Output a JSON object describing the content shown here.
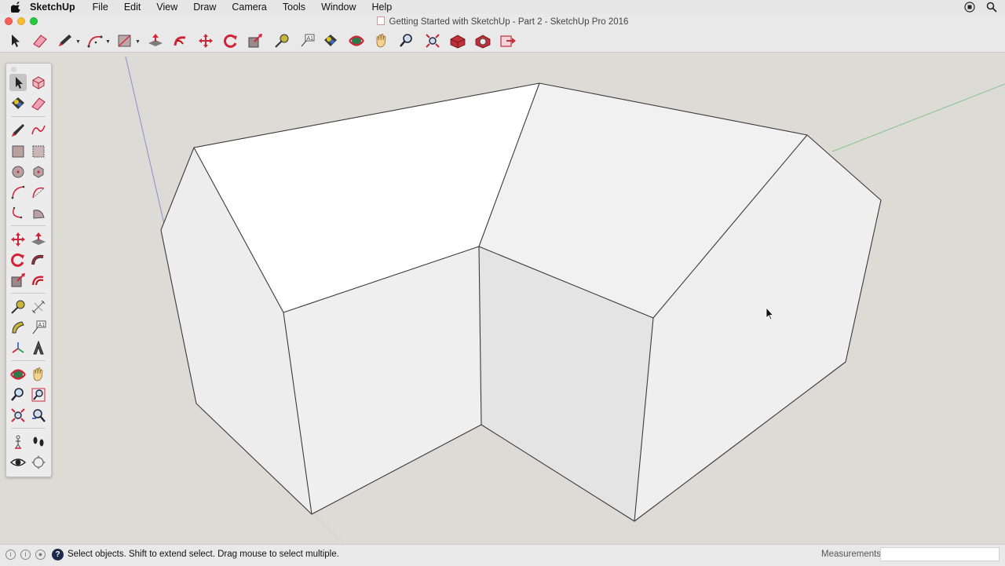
{
  "app_menu": {
    "app_name": "SketchUp",
    "items": [
      "File",
      "Edit",
      "View",
      "Draw",
      "Camera",
      "Tools",
      "Window",
      "Help"
    ]
  },
  "window": {
    "title": "Getting Started with SketchUp - Part 2 - SketchUp Pro 2016"
  },
  "toolbar": {
    "tools": [
      "select-icon",
      "eraser-icon",
      "line-pencil-icon",
      "arc-icon",
      "rectangle-icon",
      "push-pull-icon",
      "follow-me-icon",
      "move-icon",
      "rotate-icon",
      "scale-icon",
      "tape-measure-icon",
      "text-icon",
      "paint-bucket-icon",
      "orbit-icon",
      "pan-icon",
      "zoom-icon",
      "zoom-extents-icon",
      "3d-warehouse-icon",
      "extension-warehouse-icon",
      "send-to-layout-icon"
    ]
  },
  "tool_palette": {
    "selected": "select-icon",
    "tools": [
      "select-icon",
      "make-component-icon",
      "paint-bucket-icon",
      "eraser-icon",
      "line-icon",
      "freehand-icon",
      "rectangle-icon",
      "rotated-rectangle-icon",
      "circle-icon",
      "polygon-icon",
      "arc-icon",
      "two-point-arc-icon",
      "three-point-arc-icon",
      "pie-icon",
      "move-icon",
      "push-pull-icon",
      "rotate-icon",
      "follow-me-icon",
      "scale-icon",
      "offset-icon",
      "tape-measure-icon",
      "dimension-icon",
      "protractor-icon",
      "text-icon",
      "axes-icon",
      "3d-text-icon",
      "orbit-icon",
      "pan-icon",
      "zoom-icon",
      "zoom-window-icon",
      "zoom-extents-icon",
      "previous-view-icon",
      "position-camera-icon",
      "walk-icon",
      "look-around-icon",
      "section-plane-icon"
    ]
  },
  "status": {
    "message": "Select objects. Shift to extend select. Drag mouse to select multiple.",
    "measurements_label": "Measurements",
    "measurements_value": ""
  },
  "colors": {
    "viewport_bg": "#dcdbd6",
    "face_light": "#ffffff",
    "face_mid": "#efefef",
    "face_shade": "#e4e4e4",
    "edge": "#3a3a3a",
    "axis_green": "#89c38c",
    "axis_blue": "#8a8fc7",
    "tool_red": "#d0243a"
  }
}
